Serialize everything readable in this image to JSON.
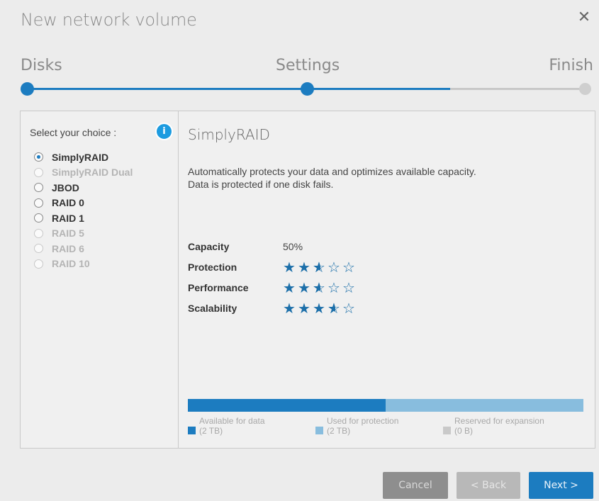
{
  "dialog": {
    "title": "New network volume",
    "close_glyph": "✕"
  },
  "wizard": {
    "steps": [
      "Disks",
      "Settings",
      "Finish"
    ],
    "progress_fraction": 0.76,
    "current_step": 2
  },
  "sidebar": {
    "select_label": "Select your choice :",
    "info_glyph": "i",
    "options": [
      {
        "label": "SimplyRAID",
        "checked": true,
        "enabled": true
      },
      {
        "label": "SimplyRAID Dual",
        "checked": false,
        "enabled": false
      },
      {
        "label": "JBOD",
        "checked": false,
        "enabled": true
      },
      {
        "label": "RAID 0",
        "checked": false,
        "enabled": true
      },
      {
        "label": "RAID 1",
        "checked": false,
        "enabled": true
      },
      {
        "label": "RAID 5",
        "checked": false,
        "enabled": false
      },
      {
        "label": "RAID 6",
        "checked": false,
        "enabled": false
      },
      {
        "label": "RAID 10",
        "checked": false,
        "enabled": false
      }
    ]
  },
  "details": {
    "title": "SimplyRAID",
    "description_line1": "Automatically protects your data and optimizes available capacity.",
    "description_line2": "Data is protected if one disk fails.",
    "capacity_label": "Capacity",
    "capacity_value": "50%",
    "ratings": [
      {
        "label": "Protection",
        "stars": 2.5,
        "max": 5
      },
      {
        "label": "Performance",
        "stars": 2.5,
        "max": 5
      },
      {
        "label": "Scalability",
        "stars": 3.5,
        "max": 5
      }
    ]
  },
  "capacity_bar": {
    "available_fraction": 0.5,
    "protection_fraction": 0.5,
    "reserved_fraction": 0.0,
    "legend": [
      {
        "line1": "Available for data",
        "line2": "(2 TB)"
      },
      {
        "line1": "Used for protection",
        "line2": "(2 TB)"
      },
      {
        "line1": "Reserved for expansion",
        "line2": "(0 B)"
      }
    ]
  },
  "buttons": {
    "cancel": "Cancel",
    "back": "< Back",
    "next": "Next >"
  },
  "colors": {
    "accent": "#1c7cc0",
    "star": "#1c6fa9"
  }
}
